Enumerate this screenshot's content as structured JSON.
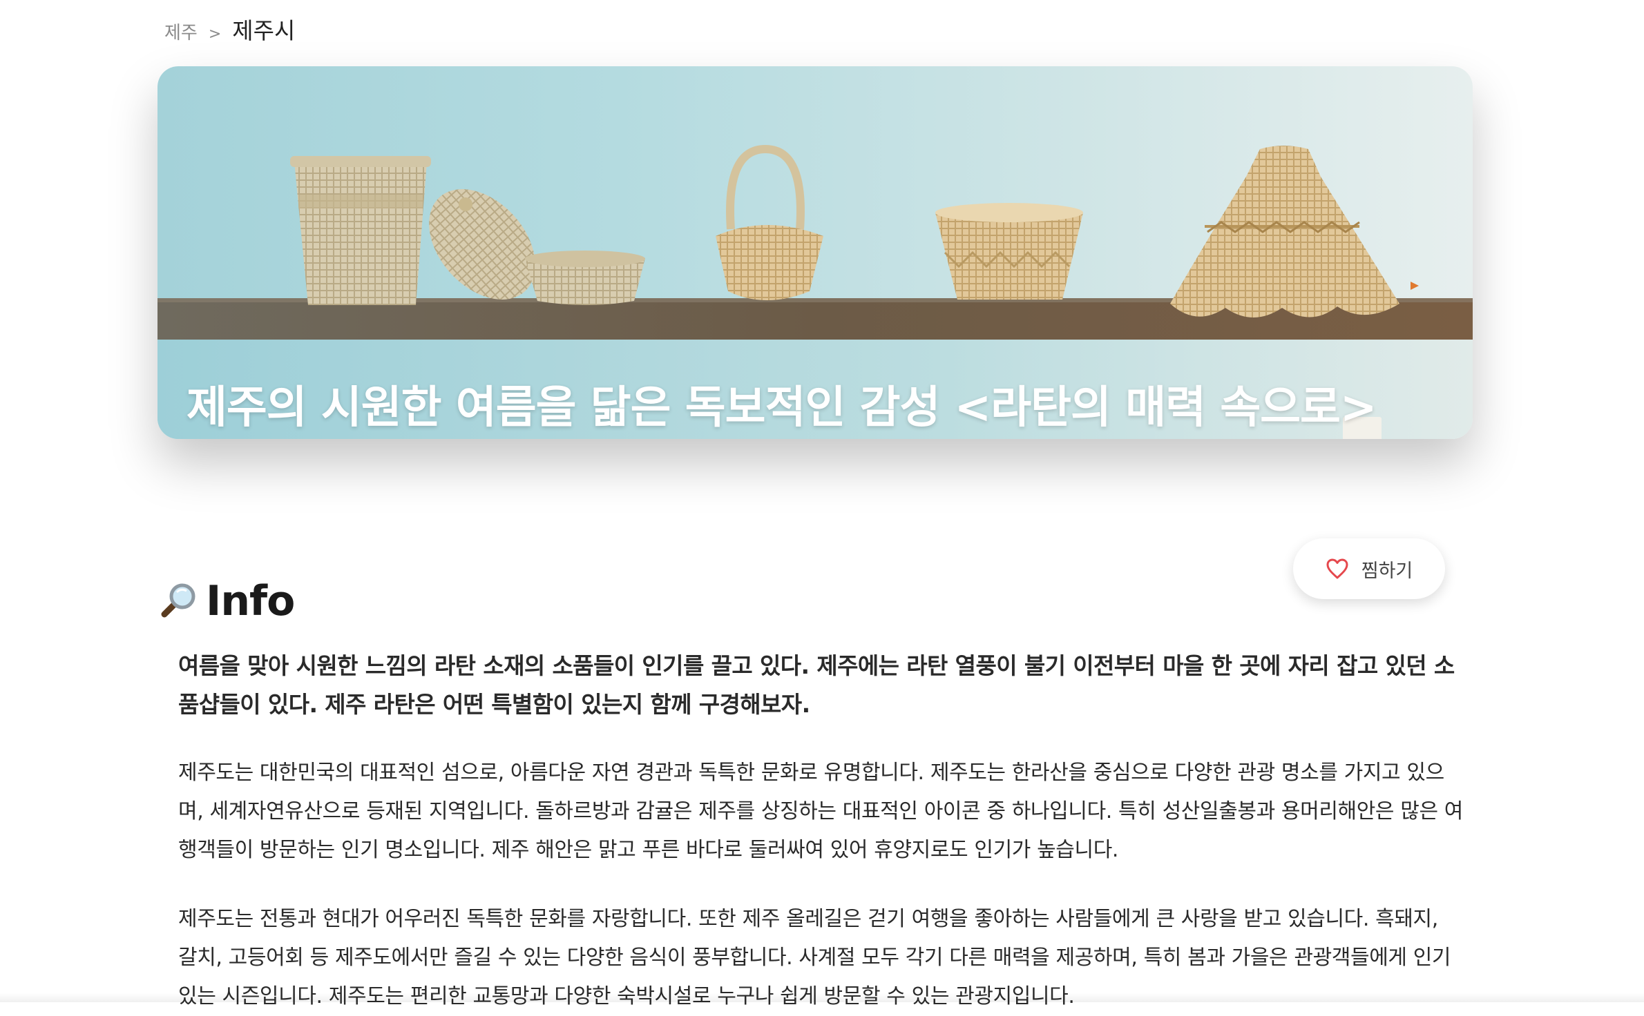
{
  "breadcrumb": {
    "root": "제주",
    "separator": ">",
    "current": "제주시"
  },
  "hero": {
    "title": "제주의 시원한 여름을 닮은 독보적인 감성 <라탄의 매력 속으로>",
    "image_subject": "rattan baskets on a wooden shelf"
  },
  "info": {
    "icon": "magnifying-glass-icon",
    "title": "Info"
  },
  "like_button": {
    "icon": "heart-outline-icon",
    "label": "찜하기",
    "color": "#e5484d"
  },
  "content": {
    "lead": "여름을 맞아 시원한 느낌의 라탄 소재의 소품들이 인기를 끌고 있다. 제주에는 라탄 열풍이 불기 이전부터 마을 한 곳에 자리 잡고 있던 소품샵들이 있다. 제주 라탄은 어떤 특별함이 있는지 함께 구경해보자.",
    "paragraphs": [
      " 제주도는 대한민국의 대표적인 섬으로, 아름다운 자연 경관과 독특한 문화로 유명합니다. 제주도는 한라산을 중심으로 다양한 관광 명소를 가지고 있으며, 세계자연유산으로 등재된 지역입니다. 돌하르방과 감귤은 제주를 상징하는 대표적인 아이콘 중 하나입니다. 특히 성산일출봉과 용머리해안은 많은 여행객들이 방문하는 인기 명소입니다. 제주 해안은 맑고 푸른 바다로 둘러싸여 있어 휴양지로도 인기가 높습니다.",
      " 제주도는 전통과 현대가 어우러진 독특한 문화를 자랑합니다. 또한 제주 올레길은 걷기 여행을 좋아하는 사람들에게 큰 사랑을 받고 있습니다. 흑돼지, 갈치, 고등어회 등 제주도에서만 즐길 수 있는 다양한 음식이 풍부합니다. 사계절 모두 각기 다른 매력을 제공하며, 특히 봄과 가을은 관광객들에게 인기 있는 시즌입니다. 제주도는 편리한 교통망과 다양한 숙박시설로 누구나 쉽게 방문할 수 있는 관광지입니다."
    ]
  }
}
